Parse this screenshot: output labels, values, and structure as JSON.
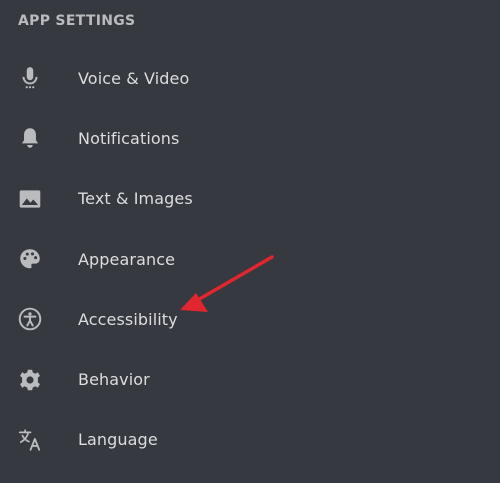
{
  "section": {
    "title": "APP SETTINGS"
  },
  "items": [
    {
      "label": "Voice & Video",
      "icon": "microphone-icon"
    },
    {
      "label": "Notifications",
      "icon": "bell-icon"
    },
    {
      "label": "Text & Images",
      "icon": "image-icon"
    },
    {
      "label": "Appearance",
      "icon": "palette-icon"
    },
    {
      "label": "Accessibility",
      "icon": "accessibility-icon"
    },
    {
      "label": "Behavior",
      "icon": "gear-icon"
    },
    {
      "label": "Language",
      "icon": "translate-icon"
    }
  ],
  "colors": {
    "background": "#36393f",
    "text": "#dcddde",
    "header": "#b9bbbe",
    "icon": "#b9bbbe",
    "annotation_arrow": "#e0262e"
  }
}
